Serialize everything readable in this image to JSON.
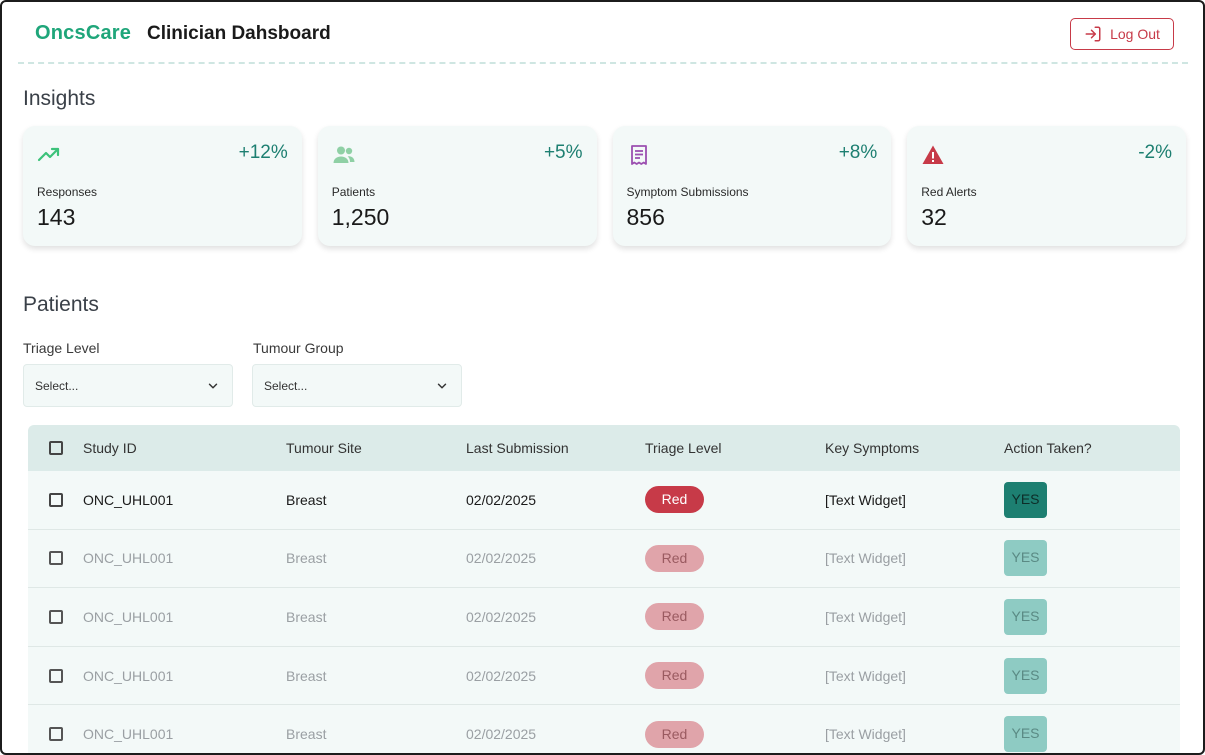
{
  "header": {
    "brand": "OncsCare",
    "title": "Clinician Dahsboard",
    "logout_label": "Log Out"
  },
  "insights": {
    "title": "Insights",
    "cards": [
      {
        "icon": "trending-up-icon",
        "change": "+12%",
        "label": "Responses",
        "value": "143",
        "icon_color": "#3cc27a"
      },
      {
        "icon": "people-icon",
        "change": "+5%",
        "label": "Patients",
        "value": "1,250",
        "icon_color": "#8fd0a5"
      },
      {
        "icon": "receipt-icon",
        "change": "+8%",
        "label": "Symptom Submissions",
        "value": "856",
        "icon_color": "#9b4fb0"
      },
      {
        "icon": "warning-icon",
        "change": "-2%",
        "label": "Red Alerts",
        "value": "32",
        "icon_color": "#c73a48"
      }
    ]
  },
  "patients": {
    "title": "Patients",
    "filters": [
      {
        "label": "Triage Level",
        "placeholder": "Select..."
      },
      {
        "label": "Tumour Group",
        "placeholder": "Select..."
      }
    ],
    "columns": [
      "Study ID",
      "Tumour Site",
      "Last Submission",
      "Triage Level",
      "Key Symptoms",
      "Action Taken?"
    ],
    "rows": [
      {
        "study_id": "ONC_UHL001",
        "site": "Breast",
        "last_submission": "02/02/2025",
        "triage": "Red",
        "symptoms": "[Text Widget]",
        "action": "YES"
      },
      {
        "study_id": "ONC_UHL001",
        "site": "Breast",
        "last_submission": "02/02/2025",
        "triage": "Red",
        "symptoms": "[Text Widget]",
        "action": "YES"
      },
      {
        "study_id": "ONC_UHL001",
        "site": "Breast",
        "last_submission": "02/02/2025",
        "triage": "Red",
        "symptoms": "[Text Widget]",
        "action": "YES"
      },
      {
        "study_id": "ONC_UHL001",
        "site": "Breast",
        "last_submission": "02/02/2025",
        "triage": "Red",
        "symptoms": "[Text Widget]",
        "action": "YES"
      },
      {
        "study_id": "ONC_UHL001",
        "site": "Breast",
        "last_submission": "02/02/2025",
        "triage": "Red",
        "symptoms": "[Text Widget]",
        "action": "YES"
      }
    ]
  },
  "colors": {
    "brand": "#1fa67a",
    "accent": "#1d7f71",
    "alert_red": "#c73a48",
    "table_header_bg": "#dcebe9",
    "card_bg": "#f3f9f8"
  }
}
